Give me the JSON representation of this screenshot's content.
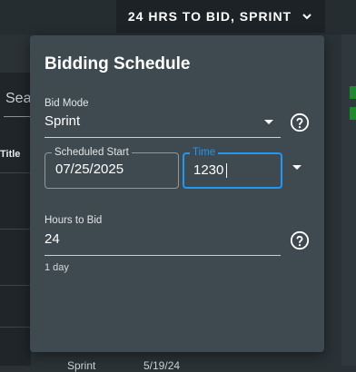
{
  "topbar": {
    "dropdown_label": "24 HRS TO BID, SPRINT"
  },
  "background": {
    "search_placeholder": "Search",
    "title_column": "Title",
    "bottom_row": {
      "left": "Sprint",
      "right": "5/19/24"
    }
  },
  "modal": {
    "title": "Bidding Schedule",
    "bid_mode": {
      "label": "Bid Mode",
      "value": "Sprint"
    },
    "scheduled_start": {
      "label": "Scheduled Start",
      "value": "07/25/2025"
    },
    "time": {
      "label": "Time",
      "value": "1230"
    },
    "hours_to_bid": {
      "label": "Hours to Bid",
      "value": "24",
      "helper": "1 day"
    }
  },
  "colors": {
    "accent": "#2196f3",
    "modal_bg": "#3e4a50",
    "status_green": "#1e8a2e"
  },
  "icons": {
    "help": "help-circle-icon",
    "dropdown": "triangle-down-icon",
    "chevron": "chevron-down-icon"
  }
}
